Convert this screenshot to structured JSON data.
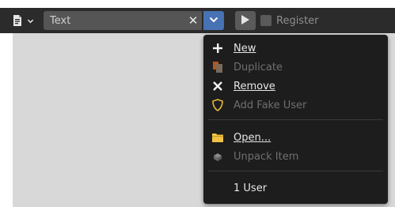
{
  "header": {
    "id_name": "Text",
    "register_label": "Register"
  },
  "menu": {
    "items": [
      {
        "label": "New",
        "enabled": true,
        "icon": "plus-icon"
      },
      {
        "label": "Duplicate",
        "enabled": false,
        "icon": "duplicate-icon"
      },
      {
        "label": "Remove",
        "enabled": true,
        "icon": "x-icon"
      },
      {
        "label": "Add Fake User",
        "enabled": false,
        "icon": "shield-icon"
      },
      {
        "label": "Open...",
        "enabled": true,
        "icon": "folder-icon"
      },
      {
        "label": "Unpack Item",
        "enabled": false,
        "icon": "unpack-icon"
      }
    ],
    "user_count": "1 User"
  },
  "colors": {
    "header_bg": "#2b2b2b",
    "accent": "#4772b3",
    "menu_bg": "#1d1d1d",
    "folder": "#f0c246",
    "disabled_text": "#6f6f6f"
  }
}
